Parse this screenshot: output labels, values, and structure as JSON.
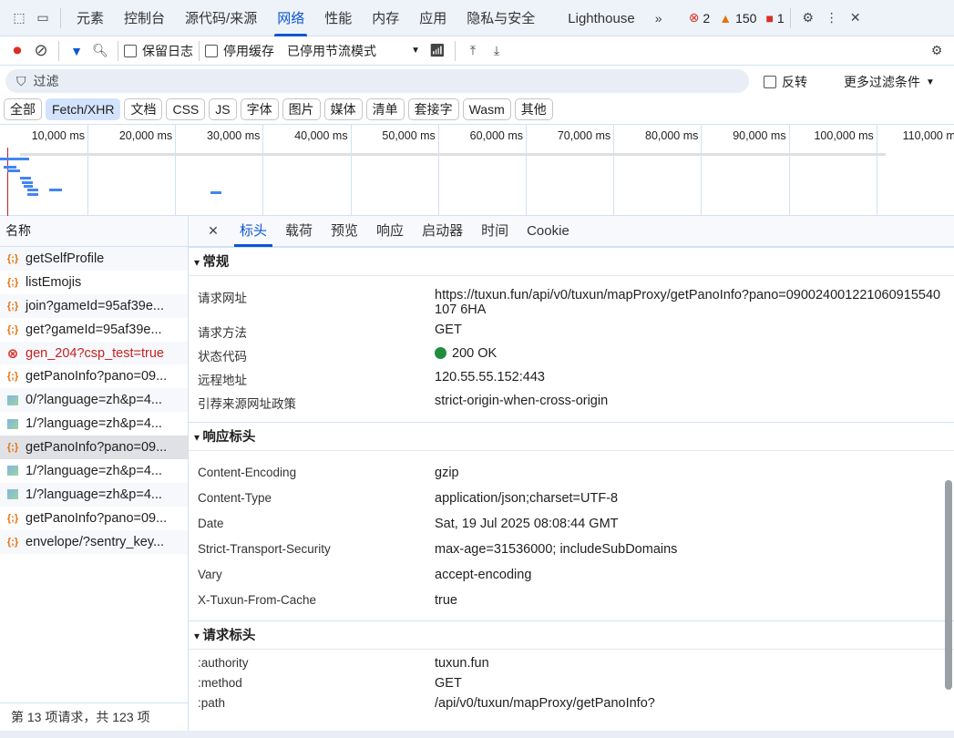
{
  "topbar": {
    "tabs": [
      "元素",
      "控制台",
      "源代码/来源",
      "网络",
      "性能",
      "内存",
      "应用",
      "隐私与安全",
      "Lighthouse"
    ],
    "active": "网络",
    "errors": "2",
    "warnings": "150",
    "issues": "1"
  },
  "toolbar": {
    "preserve_log": "保留日志",
    "disable_cache": "停用缓存",
    "throttle": "已停用节流模式"
  },
  "filter": {
    "placeholder": "过滤",
    "invert": "反转",
    "more": "更多过滤条件"
  },
  "chips": [
    "全部",
    "Fetch/XHR",
    "文档",
    "CSS",
    "JS",
    "字体",
    "图片",
    "媒体",
    "清单",
    "套接字",
    "Wasm",
    "其他"
  ],
  "timeline": {
    "ticks": [
      "10,000 ms",
      "20,000 ms",
      "30,000 ms",
      "40,000 ms",
      "50,000 ms",
      "60,000 ms",
      "70,000 ms",
      "80,000 ms",
      "90,000 ms",
      "100,000 ms",
      "110,000 ms"
    ]
  },
  "list": {
    "header": "名称",
    "requests": [
      {
        "name": "getSelfProfile",
        "type": "fetch"
      },
      {
        "name": "listEmojis",
        "type": "fetch"
      },
      {
        "name": "join?gameId=95af39e...",
        "type": "fetch"
      },
      {
        "name": "get?gameId=95af39e...",
        "type": "fetch"
      },
      {
        "name": "gen_204?csp_test=true",
        "type": "error"
      },
      {
        "name": "getPanoInfo?pano=09...",
        "type": "fetch"
      },
      {
        "name": "0/?language=zh&p=4...",
        "type": "image"
      },
      {
        "name": "1/?language=zh&p=4...",
        "type": "image"
      },
      {
        "name": "getPanoInfo?pano=09...",
        "type": "fetch",
        "selected": true
      },
      {
        "name": "1/?language=zh&p=4...",
        "type": "image"
      },
      {
        "name": "1/?language=zh&p=4...",
        "type": "image"
      },
      {
        "name": "getPanoInfo?pano=09...",
        "type": "fetch"
      },
      {
        "name": "envelope/?sentry_key...",
        "type": "fetch"
      }
    ],
    "status": "第 13 项请求，共 123 项"
  },
  "details": {
    "tabs": [
      "标头",
      "载荷",
      "预览",
      "响应",
      "启动器",
      "时间",
      "Cookie"
    ],
    "active": "标头",
    "general": {
      "title": "常规",
      "rows": [
        [
          "请求网址",
          "https://tuxun.fun/api/v0/tuxun/mapProxy/getPanoInfo?pano=090024001221060915540107 6HA"
        ],
        [
          "请求方法",
          "GET"
        ],
        [
          "状态代码",
          "200 OK"
        ],
        [
          "远程地址",
          "120.55.55.152:443"
        ],
        [
          "引荐来源网址政策",
          "strict-origin-when-cross-origin"
        ]
      ]
    },
    "response": {
      "title": "响应标头",
      "rows": [
        [
          "Content-Encoding",
          "gzip"
        ],
        [
          "Content-Type",
          "application/json;charset=UTF-8"
        ],
        [
          "Date",
          "Sat, 19 Jul 2025 08:08:44 GMT"
        ],
        [
          "Strict-Transport-Security",
          "max-age=31536000; includeSubDomains"
        ],
        [
          "Vary",
          "accept-encoding"
        ],
        [
          "X-Tuxun-From-Cache",
          "true"
        ]
      ]
    },
    "request": {
      "title": "请求标头",
      "rows": [
        [
          ":authority",
          "tuxun.fun"
        ],
        [
          ":method",
          "GET"
        ],
        [
          ":path",
          "/api/v0/tuxun/mapProxy/getPanoInfo?"
        ]
      ]
    }
  },
  "colors": {
    "accent": "#0b57d0",
    "error": "#d93025",
    "ok": "#1e8e3e"
  }
}
